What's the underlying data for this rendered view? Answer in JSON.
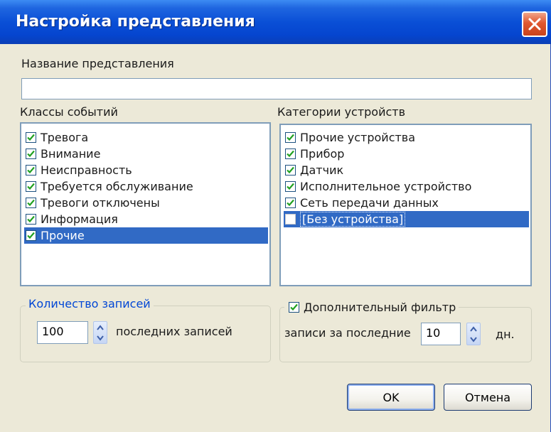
{
  "window": {
    "title": "Настройка представления"
  },
  "name_field": {
    "label": "Название представления",
    "value": ""
  },
  "event_classes": {
    "label": "Классы событий",
    "items": [
      {
        "label": "Тревога",
        "checked": true,
        "selected": false
      },
      {
        "label": "Внимание",
        "checked": true,
        "selected": false
      },
      {
        "label": "Неисправность",
        "checked": true,
        "selected": false
      },
      {
        "label": "Требуется обслуживание",
        "checked": true,
        "selected": false
      },
      {
        "label": "Тревоги отключены",
        "checked": true,
        "selected": false
      },
      {
        "label": "Информация",
        "checked": true,
        "selected": false
      },
      {
        "label": "Прочие",
        "checked": true,
        "selected": true
      }
    ]
  },
  "device_categories": {
    "label": "Категории устройств",
    "items": [
      {
        "label": "Прочие устройства",
        "checked": true,
        "selected": false
      },
      {
        "label": "Прибор",
        "checked": true,
        "selected": false
      },
      {
        "label": "Датчик",
        "checked": true,
        "selected": false
      },
      {
        "label": "Исполнительное устройство",
        "checked": true,
        "selected": false
      },
      {
        "label": "Сеть передачи данных",
        "checked": true,
        "selected": false
      },
      {
        "label": "[Без устройства]",
        "checked": false,
        "selected": true
      }
    ]
  },
  "records_count": {
    "legend": "Количество записей",
    "value": "100",
    "suffix": "последних записей"
  },
  "extra_filter": {
    "label": "Дополнительный фильтр",
    "checked": true,
    "prefix": "записи за последние",
    "value": "10",
    "suffix": "дн."
  },
  "buttons": {
    "ok": "OK",
    "cancel": "Отмена"
  },
  "colors": {
    "title_bar": "#0a4fd6",
    "selection": "#316ac5",
    "group_legend": "#0046d5",
    "close_button": "#e0572f"
  }
}
